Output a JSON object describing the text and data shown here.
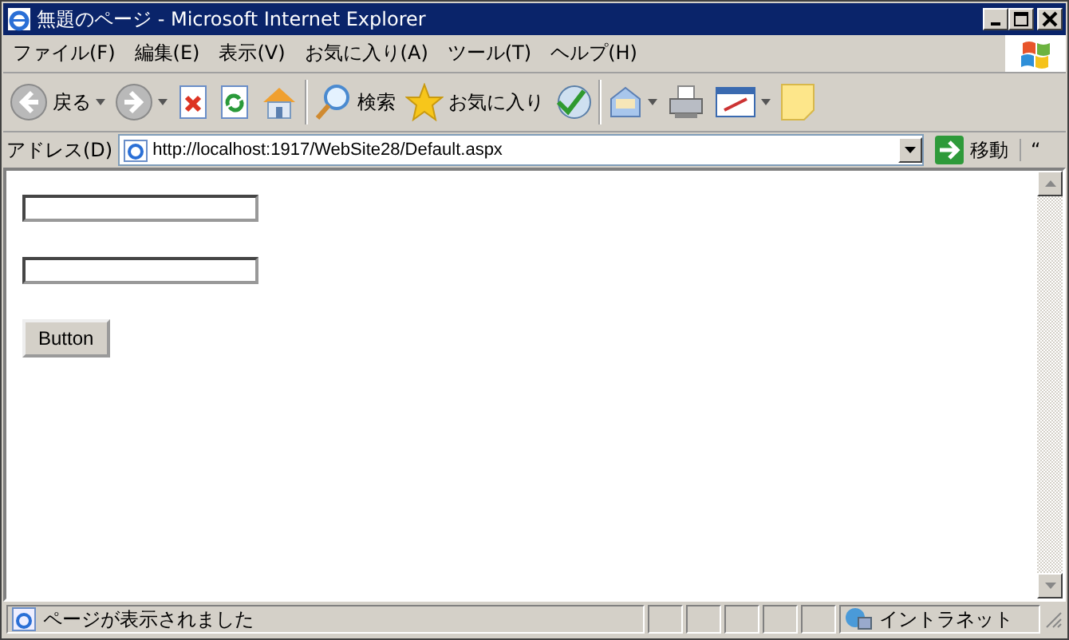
{
  "window": {
    "title": "無題のページ - Microsoft Internet Explorer"
  },
  "menu": [
    "ファイル(F)",
    "編集(E)",
    "表示(V)",
    "お気に入り(A)",
    "ツール(T)",
    "ヘルプ(H)"
  ],
  "toolbar": [
    {
      "kind": "back",
      "label": "戻る"
    },
    {
      "kind": "forward"
    },
    {
      "kind": "stop"
    },
    {
      "kind": "refresh"
    },
    {
      "kind": "home"
    },
    {
      "kind": "search",
      "label": "検索"
    },
    {
      "kind": "favorites",
      "label": "お気に入り"
    },
    {
      "kind": "history"
    },
    {
      "kind": "mail"
    },
    {
      "kind": "print"
    },
    {
      "kind": "edit"
    },
    {
      "kind": "note"
    }
  ],
  "address": {
    "label": "アドレス(D)",
    "url": "http://localhost:1917/WebSite28/Default.aspx",
    "go": "移動",
    "links": "“"
  },
  "form": [
    {
      "kind": "textbox"
    },
    {
      "kind": "textbox"
    },
    {
      "kind": "button",
      "label": "Button"
    }
  ],
  "status_bar": {
    "text": "ページが表示されました",
    "zone": "イントラネット"
  }
}
